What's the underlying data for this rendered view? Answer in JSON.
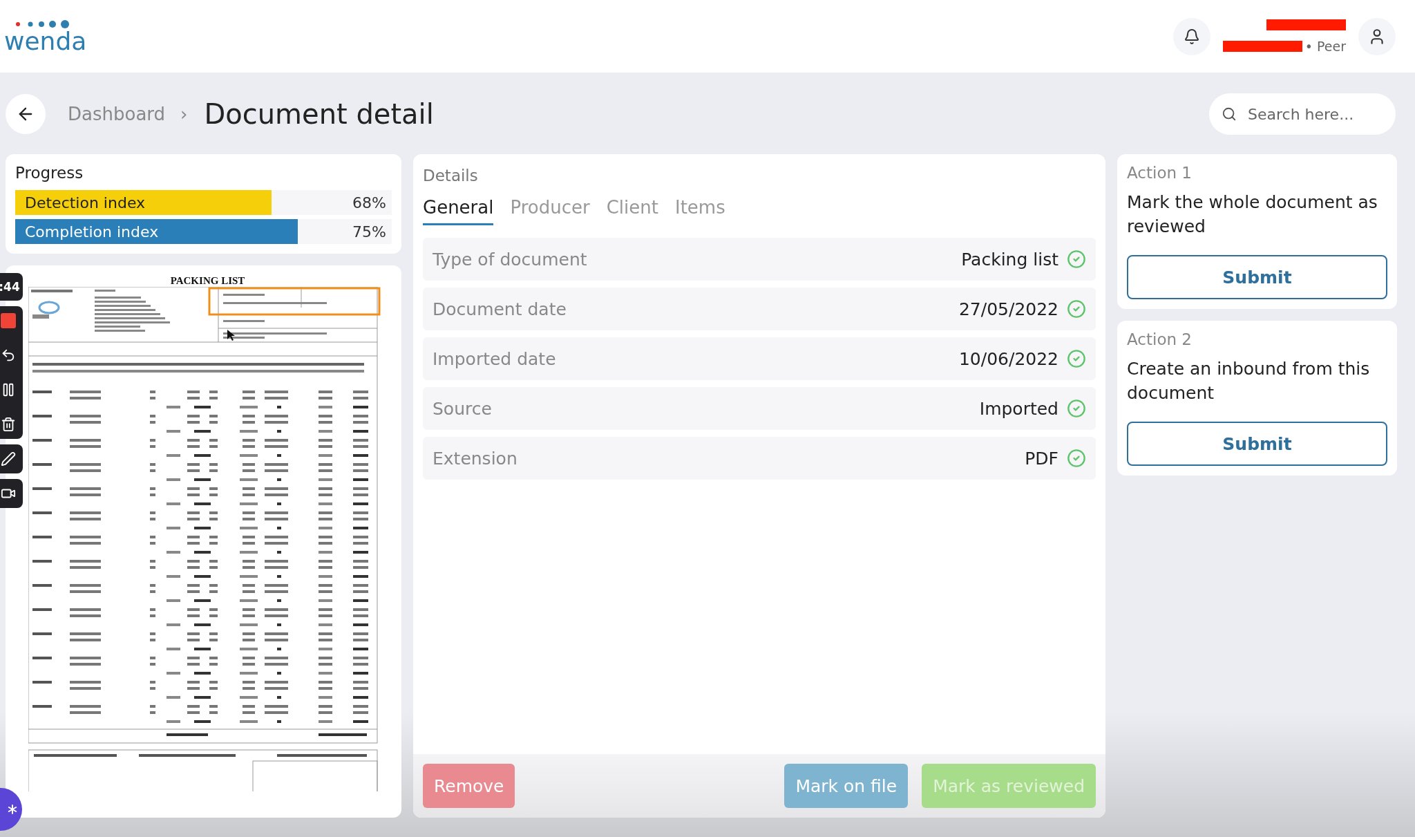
{
  "header": {
    "logo": "wenda",
    "user_role": "• Peer"
  },
  "breadcrumb": {
    "parent": "Dashboard",
    "separator": "›",
    "title": "Document detail"
  },
  "search": {
    "placeholder": "Search here..."
  },
  "progress": {
    "title": "Progress",
    "bars": [
      {
        "label": "Detection index",
        "level": 0.68,
        "reading": "68%",
        "color": "#f5cf0a"
      },
      {
        "label": "Completion index",
        "level": 0.75,
        "reading": "75%",
        "color": "#2a7fb8"
      }
    ]
  },
  "preview": {
    "title": "PACKING LIST"
  },
  "recorder": {
    "timer": ":44"
  },
  "details": {
    "title": "Details",
    "tabs": [
      {
        "label": "General",
        "selected": true
      },
      {
        "label": "Producer",
        "selected": false
      },
      {
        "label": "Client",
        "selected": false
      },
      {
        "label": "Items",
        "selected": false
      }
    ],
    "fields": [
      {
        "label": "Type of document",
        "value": "Packing list",
        "verified": true
      },
      {
        "label": "Document date",
        "value": "27/05/2022",
        "verified": true
      },
      {
        "label": "Imported date",
        "value": "10/06/2022",
        "verified": true
      },
      {
        "label": "Source",
        "value": "Imported",
        "verified": true
      },
      {
        "label": "Extension",
        "value": "PDF",
        "verified": true
      }
    ],
    "buttons": [
      {
        "label": "Remove",
        "kind": "danger"
      },
      {
        "label": "Mark on file",
        "kind": "info"
      },
      {
        "label": "Mark as reviewed",
        "kind": "success"
      }
    ]
  },
  "actions": [
    {
      "title": "Action 1",
      "description": "Mark the whole document as reviewed",
      "button": "Submit"
    },
    {
      "title": "Action 2",
      "description": "Create an inbound from this document",
      "button": "Submit"
    }
  ]
}
